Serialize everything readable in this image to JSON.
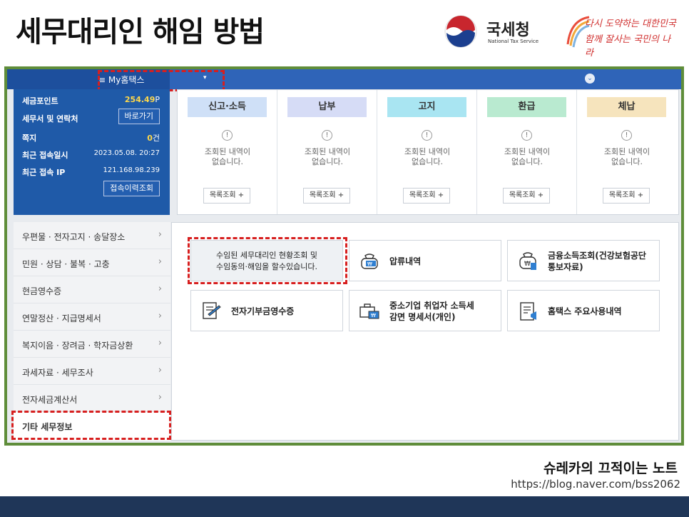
{
  "slide": {
    "title": "세무대리인 해임 방법",
    "author": "슈레카의 끄적이는 노트",
    "url": "https://blog.naver.com/bss2062"
  },
  "logos": {
    "nts_name": "국세청",
    "nts_sub": "National Tax Service",
    "slogan_line1": "다시 도약하는 대한민국",
    "slogan_line2": "함께 잘사는 국민의 나라"
  },
  "topbar": {
    "menu_label": "≡  My홈택스",
    "caret": "▾",
    "toggle": "⌄"
  },
  "info": {
    "points_label": "세금포인트",
    "points_value": "254.49",
    "points_unit": "P",
    "notices_label": "세무서 및 연락처",
    "notices_button": "바로가기",
    "messages_label": "쪽지",
    "messages_value": "0",
    "messages_unit": "건",
    "last_login_label": "최근 접속일시",
    "last_login_value": "2023.05.08.  20:27",
    "last_ip_label": "최근 접속 IP",
    "last_ip_value": "121.168.98.239",
    "history_button": "접속이력조회"
  },
  "cards": [
    {
      "title": "신고·소득",
      "color": "#cfe0f7",
      "message": "조회된 내역이\n없습니다.",
      "button": "목록조회 +"
    },
    {
      "title": "납부",
      "color": "#d6dcf6",
      "message": "조회된 내역이\n없습니다.",
      "button": "목록조회 +"
    },
    {
      "title": "고지",
      "color": "#a9e5f2",
      "message": "조회된 내역이\n없습니다.",
      "button": "목록조회 +"
    },
    {
      "title": "환급",
      "color": "#b9ead0",
      "message": "조회된 내역이\n없습니다.",
      "button": "목록조회 +"
    },
    {
      "title": "체납",
      "color": "#f6e4bd",
      "message": "조회된 내역이\n없습니다.",
      "button": "목록조회 +"
    }
  ],
  "card_icon": "!",
  "side_menu": [
    {
      "label": "우편물 · 전자고지 · 송달장소",
      "chevron": "›"
    },
    {
      "label": "민원 · 상담 · 불복 · 고충",
      "chevron": "›"
    },
    {
      "label": "현금영수증",
      "chevron": "›"
    },
    {
      "label": "연말정산 · 지급명세서",
      "chevron": "›"
    },
    {
      "label": "복지이음 · 장려금 · 학자금상환",
      "chevron": "›"
    },
    {
      "label": "과세자료 · 세무조사",
      "chevron": "›"
    },
    {
      "label": "전자세금계산서",
      "chevron": "›"
    },
    {
      "label": "기타 세무정보",
      "chevron": ""
    }
  ],
  "services": {
    "highlight": "수임된 세무대리인 현황조회 및\n수임동의·해임을 할수있습니다.",
    "seizure": "압류내역",
    "financial_income": "금융소득조회(건강보험공단\n통보자료)",
    "donation_receipt": "전자기부금영수증",
    "sme_tax": "중소기업 취업자 소득세\n감면 명세서(개인)",
    "hometax_usage": "홈택스 주요사용내역"
  },
  "colors": {
    "frame_border": "#5f8d3a",
    "topbar": "#2f64b8",
    "infobox": "#1f5aa8",
    "highlight_dash": "#d71f1f",
    "points": "#ffd84a"
  }
}
